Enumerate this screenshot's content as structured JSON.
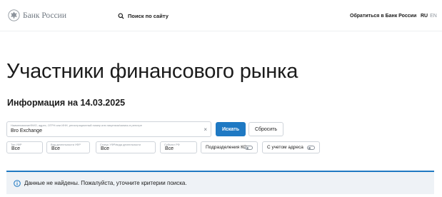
{
  "header": {
    "logo_text": "Банк России",
    "search_label": "Поиск по сайту",
    "contact_label": "Обратиться в Банк России",
    "lang_ru": "RU",
    "lang_en": "EN"
  },
  "page": {
    "title": "Участники финансового рынка",
    "info_date": "Информация на 14.03.2025"
  },
  "search": {
    "field_label": "Наименование/ФИО, адрес, ОГРН или ИНН, регистрационный номер или лицензии/запись в реестре",
    "field_value": "Bro Exchange",
    "search_button": "Искать",
    "reset_button": "Сбросить"
  },
  "filters": {
    "type_label": "Тип УФР",
    "type_value": "Все",
    "activity_label": "Вид деятельности УФР",
    "activity_value": "Все",
    "status_label": "Статус УФР/вида деятельности",
    "status_value": "Все",
    "subject_label": "Субъект РФ",
    "subject_value": "Все",
    "toggle_ko_label": "Подразделения КО",
    "toggle_address_label": "С учетом адреса"
  },
  "notice": {
    "message": "Данные не найдены. Пожалуйста, уточните критерии поиска."
  },
  "colors": {
    "accent": "#1f79c3",
    "notice_bg": "#eef2f6",
    "border": "#cfd4da",
    "muted_text": "#8d949c"
  }
}
